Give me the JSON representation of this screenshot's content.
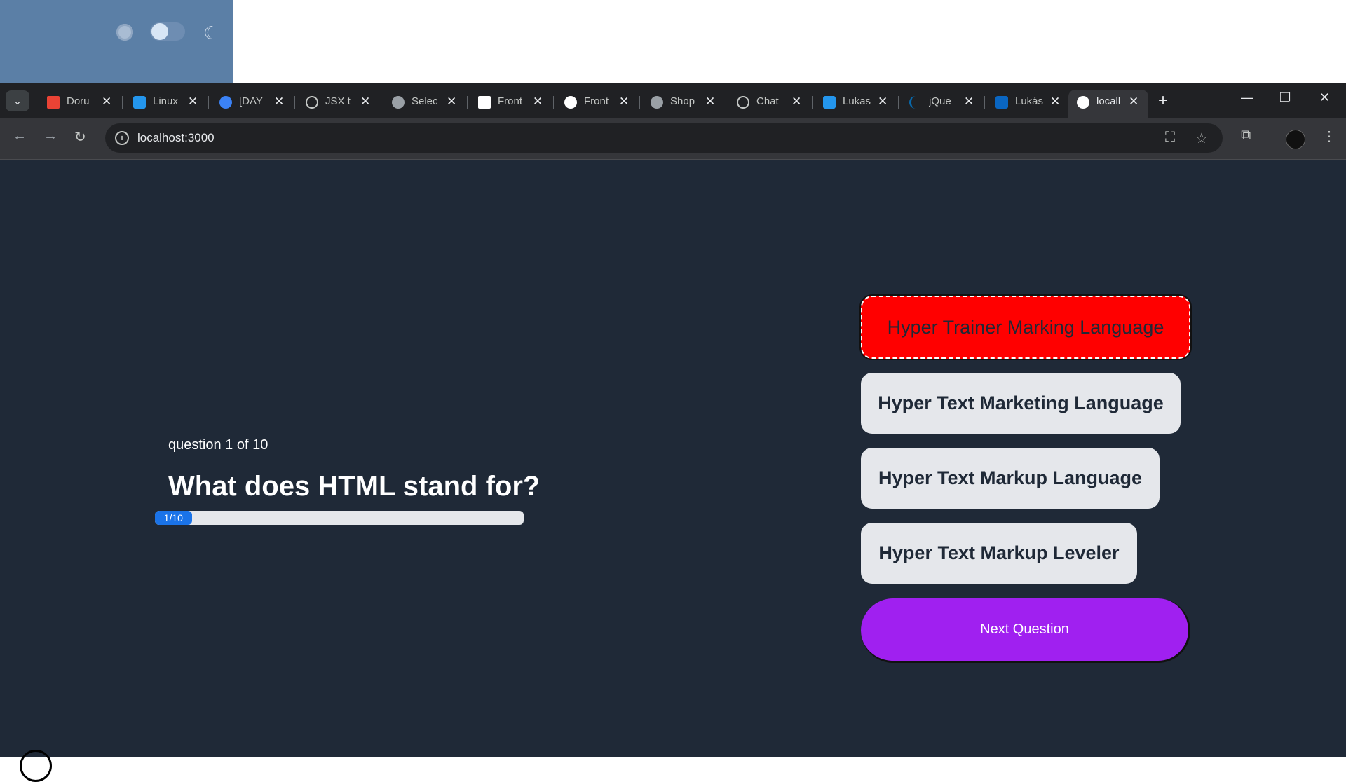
{
  "browser": {
    "tabs": [
      {
        "title": "Doru",
        "favicon": "gmail-icon",
        "color": "#ea4335"
      },
      {
        "title": "Linux",
        "favicon": "docker-icon",
        "color": "#2496ed"
      },
      {
        "title": "[DAY",
        "favicon": "hex-icon",
        "color": "#3b82f6"
      },
      {
        "title": "JSX t",
        "favicon": "openai-icon",
        "color": "#c4c7c5"
      },
      {
        "title": "Selec",
        "favicon": "globe-icon",
        "color": "#c4c7c5"
      },
      {
        "title": "Front",
        "favicon": "page-icon",
        "color": "#ffffff"
      },
      {
        "title": "Front",
        "favicon": "frontend-icon",
        "color": "#ffffff"
      },
      {
        "title": "Shop",
        "favicon": "globe-icon",
        "color": "#c4c7c5"
      },
      {
        "title": "Chat",
        "favicon": "openai-icon",
        "color": "#c4c7c5"
      },
      {
        "title": "Lukas",
        "favicon": "docker-icon",
        "color": "#2496ed"
      },
      {
        "title": "jQue",
        "favicon": "jquery-icon",
        "color": "#0769ad"
      },
      {
        "title": "Lukás",
        "favicon": "linkedin-icon",
        "color": "#0a66c2"
      },
      {
        "title": "locall",
        "favicon": "nextjs-icon",
        "color": "#ffffff",
        "active": true
      }
    ],
    "url": "localhost:3000"
  },
  "quiz": {
    "question_counter": "question 1 of 10",
    "question": "What does HTML stand for?",
    "progress_label": "1/10",
    "progress_fraction": 0.1,
    "answers": [
      {
        "label": "Hyper Trainer Marking Language",
        "state": "wrong"
      },
      {
        "label": "Hyper Text Marketing Language",
        "state": "default"
      },
      {
        "label": "Hyper Text Markup Language",
        "state": "default"
      },
      {
        "label": "Hyper Text Markup Leveler",
        "state": "default"
      }
    ],
    "next_button": "Next Question"
  },
  "colors": {
    "page_bg": "#1f2937",
    "wrong": "#ff0000",
    "next": "#a020f0",
    "progress": "#1a73e8"
  }
}
